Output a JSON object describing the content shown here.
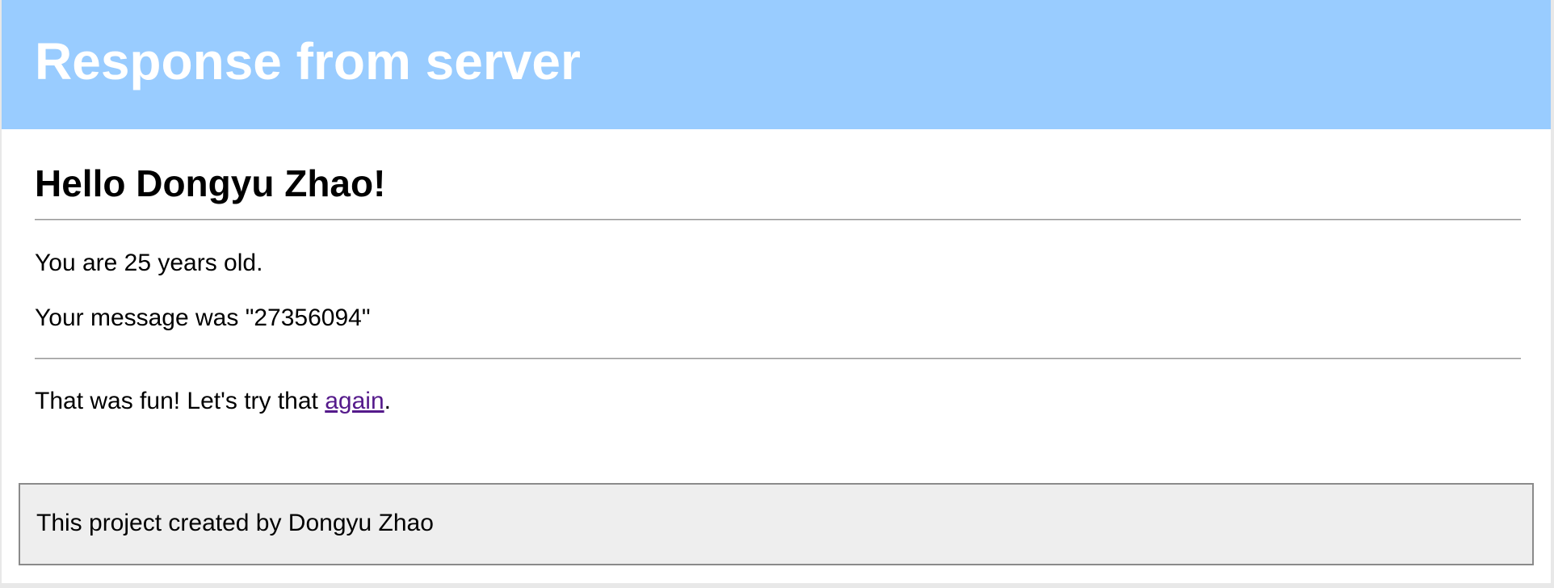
{
  "header": {
    "title": "Response from server"
  },
  "main": {
    "greeting": "Hello Dongyu Zhao!",
    "age_text": "You are 25 years old.",
    "message_text": "Your message was \"27356094\"",
    "fun_prefix": "That was fun! Let's try that ",
    "again_link_label": "again",
    "fun_suffix": "."
  },
  "footer": {
    "text": "This project created by Dongyu Zhao"
  },
  "colors": {
    "header_background": "#99ccff",
    "header_text": "#ffffff",
    "visited_link": "#551a8b",
    "footer_background": "#eeeeee"
  }
}
